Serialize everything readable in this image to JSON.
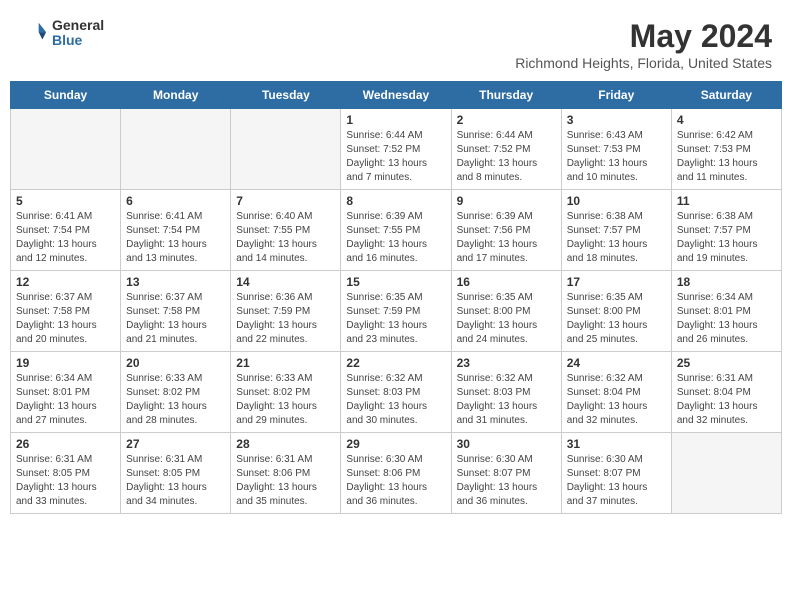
{
  "header": {
    "logo_general": "General",
    "logo_blue": "Blue",
    "month_year": "May 2024",
    "location": "Richmond Heights, Florida, United States"
  },
  "days_of_week": [
    "Sunday",
    "Monday",
    "Tuesday",
    "Wednesday",
    "Thursday",
    "Friday",
    "Saturday"
  ],
  "weeks": [
    [
      {
        "day": "",
        "info": ""
      },
      {
        "day": "",
        "info": ""
      },
      {
        "day": "",
        "info": ""
      },
      {
        "day": "1",
        "info": "Sunrise: 6:44 AM\nSunset: 7:52 PM\nDaylight: 13 hours\nand 7 minutes."
      },
      {
        "day": "2",
        "info": "Sunrise: 6:44 AM\nSunset: 7:52 PM\nDaylight: 13 hours\nand 8 minutes."
      },
      {
        "day": "3",
        "info": "Sunrise: 6:43 AM\nSunset: 7:53 PM\nDaylight: 13 hours\nand 10 minutes."
      },
      {
        "day": "4",
        "info": "Sunrise: 6:42 AM\nSunset: 7:53 PM\nDaylight: 13 hours\nand 11 minutes."
      }
    ],
    [
      {
        "day": "5",
        "info": "Sunrise: 6:41 AM\nSunset: 7:54 PM\nDaylight: 13 hours\nand 12 minutes."
      },
      {
        "day": "6",
        "info": "Sunrise: 6:41 AM\nSunset: 7:54 PM\nDaylight: 13 hours\nand 13 minutes."
      },
      {
        "day": "7",
        "info": "Sunrise: 6:40 AM\nSunset: 7:55 PM\nDaylight: 13 hours\nand 14 minutes."
      },
      {
        "day": "8",
        "info": "Sunrise: 6:39 AM\nSunset: 7:55 PM\nDaylight: 13 hours\nand 16 minutes."
      },
      {
        "day": "9",
        "info": "Sunrise: 6:39 AM\nSunset: 7:56 PM\nDaylight: 13 hours\nand 17 minutes."
      },
      {
        "day": "10",
        "info": "Sunrise: 6:38 AM\nSunset: 7:57 PM\nDaylight: 13 hours\nand 18 minutes."
      },
      {
        "day": "11",
        "info": "Sunrise: 6:38 AM\nSunset: 7:57 PM\nDaylight: 13 hours\nand 19 minutes."
      }
    ],
    [
      {
        "day": "12",
        "info": "Sunrise: 6:37 AM\nSunset: 7:58 PM\nDaylight: 13 hours\nand 20 minutes."
      },
      {
        "day": "13",
        "info": "Sunrise: 6:37 AM\nSunset: 7:58 PM\nDaylight: 13 hours\nand 21 minutes."
      },
      {
        "day": "14",
        "info": "Sunrise: 6:36 AM\nSunset: 7:59 PM\nDaylight: 13 hours\nand 22 minutes."
      },
      {
        "day": "15",
        "info": "Sunrise: 6:35 AM\nSunset: 7:59 PM\nDaylight: 13 hours\nand 23 minutes."
      },
      {
        "day": "16",
        "info": "Sunrise: 6:35 AM\nSunset: 8:00 PM\nDaylight: 13 hours\nand 24 minutes."
      },
      {
        "day": "17",
        "info": "Sunrise: 6:35 AM\nSunset: 8:00 PM\nDaylight: 13 hours\nand 25 minutes."
      },
      {
        "day": "18",
        "info": "Sunrise: 6:34 AM\nSunset: 8:01 PM\nDaylight: 13 hours\nand 26 minutes."
      }
    ],
    [
      {
        "day": "19",
        "info": "Sunrise: 6:34 AM\nSunset: 8:01 PM\nDaylight: 13 hours\nand 27 minutes."
      },
      {
        "day": "20",
        "info": "Sunrise: 6:33 AM\nSunset: 8:02 PM\nDaylight: 13 hours\nand 28 minutes."
      },
      {
        "day": "21",
        "info": "Sunrise: 6:33 AM\nSunset: 8:02 PM\nDaylight: 13 hours\nand 29 minutes."
      },
      {
        "day": "22",
        "info": "Sunrise: 6:32 AM\nSunset: 8:03 PM\nDaylight: 13 hours\nand 30 minutes."
      },
      {
        "day": "23",
        "info": "Sunrise: 6:32 AM\nSunset: 8:03 PM\nDaylight: 13 hours\nand 31 minutes."
      },
      {
        "day": "24",
        "info": "Sunrise: 6:32 AM\nSunset: 8:04 PM\nDaylight: 13 hours\nand 32 minutes."
      },
      {
        "day": "25",
        "info": "Sunrise: 6:31 AM\nSunset: 8:04 PM\nDaylight: 13 hours\nand 32 minutes."
      }
    ],
    [
      {
        "day": "26",
        "info": "Sunrise: 6:31 AM\nSunset: 8:05 PM\nDaylight: 13 hours\nand 33 minutes."
      },
      {
        "day": "27",
        "info": "Sunrise: 6:31 AM\nSunset: 8:05 PM\nDaylight: 13 hours\nand 34 minutes."
      },
      {
        "day": "28",
        "info": "Sunrise: 6:31 AM\nSunset: 8:06 PM\nDaylight: 13 hours\nand 35 minutes."
      },
      {
        "day": "29",
        "info": "Sunrise: 6:30 AM\nSunset: 8:06 PM\nDaylight: 13 hours\nand 36 minutes."
      },
      {
        "day": "30",
        "info": "Sunrise: 6:30 AM\nSunset: 8:07 PM\nDaylight: 13 hours\nand 36 minutes."
      },
      {
        "day": "31",
        "info": "Sunrise: 6:30 AM\nSunset: 8:07 PM\nDaylight: 13 hours\nand 37 minutes."
      },
      {
        "day": "",
        "info": ""
      }
    ]
  ]
}
